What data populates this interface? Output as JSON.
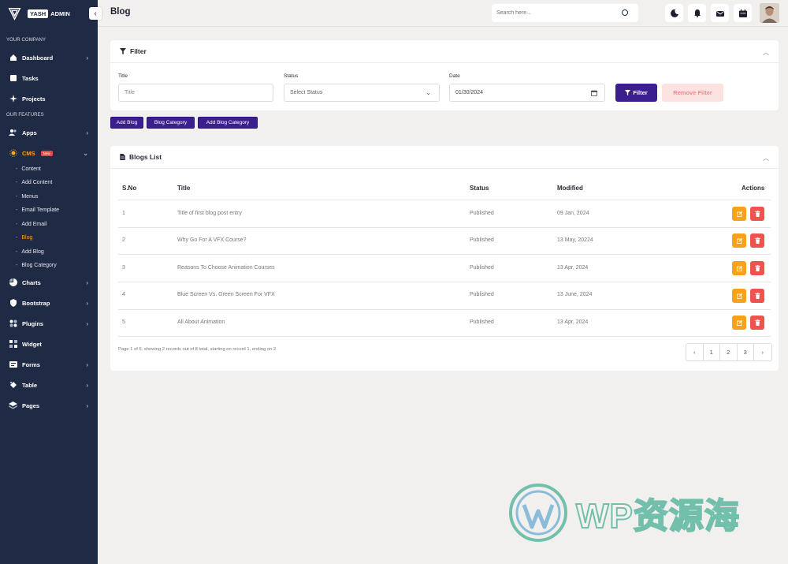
{
  "brand": {
    "badge_left": "YASH",
    "badge_right": "ADMIN"
  },
  "sidebar": {
    "section_company": "YOUR COMPANY",
    "dashboard": "Dashboard",
    "tasks": "Tasks",
    "projects": "Projects",
    "section_features": "OUR FEATURES",
    "apps": "Apps",
    "cms": "CMS",
    "cms_badge": "New",
    "cms_sub": [
      "Content",
      "Add Content",
      "Menus",
      "Email Template",
      "Add Email",
      "Blog",
      "Add Blog",
      "Blog Category"
    ],
    "charts": "Charts",
    "bootstrap": "Bootstrap",
    "plugins": "Plugins",
    "widget": "Widget",
    "forms": "Forms",
    "table": "Table",
    "pages": "Pages"
  },
  "header": {
    "title": "Blog",
    "search_placeholder": "Search here..."
  },
  "filter": {
    "heading": "Filter",
    "title_label": "Title",
    "title_placeholder": "Title",
    "status_label": "Status",
    "status_value": "Select Status",
    "date_label": "Date",
    "date_value": "01/30/2024",
    "filter_button": "Filter",
    "remove_button": "Remove Filter"
  },
  "actions": {
    "add_blog": "Add Blog",
    "blog_category": "Blog Category",
    "add_blog_category": "Add Blog Category"
  },
  "blogs": {
    "heading": "Blogs List",
    "columns": {
      "sno": "S.No",
      "title": "Title",
      "status": "Status",
      "modified": "Modified",
      "actions": "Actions"
    },
    "rows": [
      {
        "sno": "1",
        "title": "Title of first blog post entry",
        "status": "Published",
        "modified": "09 Jan, 2024"
      },
      {
        "sno": "2",
        "title": "Why Go For A VFX Course?",
        "status": "Published",
        "modified": "13 May, 20224"
      },
      {
        "sno": "3",
        "title": "Reasons To Choose Animation Courses",
        "status": "Published",
        "modified": "13 Apr, 2024"
      },
      {
        "sno": "4",
        "title": "Blue Screen Vs. Green Screen For VFX",
        "status": "Published",
        "modified": "13 June, 2024"
      },
      {
        "sno": "5",
        "title": "All About Animation",
        "status": "Published",
        "modified": "13 Apr, 2024"
      }
    ],
    "footer": "Page 1 of 5, showing 2 records out of 8 total, starting on record 1, ending on 2",
    "pages": [
      "1",
      "2",
      "3"
    ]
  },
  "watermark": {
    "text": "WP资源海"
  },
  "colors": {
    "sidebar_bg": "#1f2a44",
    "accent": "#3b1f8e",
    "active": "#f5a623",
    "edit": "#f7a21b",
    "delete": "#ef5350"
  }
}
